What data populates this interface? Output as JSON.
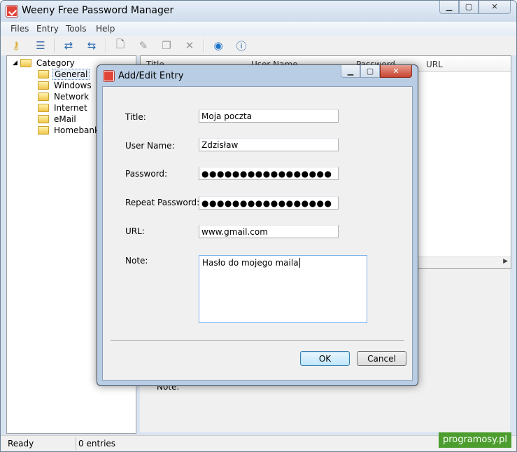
{
  "app": {
    "title": "Weeny Free Password Manager"
  },
  "menu": [
    "Files",
    "Entry",
    "Tools",
    "Help"
  ],
  "toolbar_icons": [
    "key-icon",
    "list-icon",
    "import-icon",
    "export-icon",
    "new-entry-icon",
    "edit-entry-icon",
    "copy-entry-icon",
    "delete-entry-icon",
    "globe-icon",
    "info-icon"
  ],
  "tree": {
    "root": "Category",
    "items": [
      "General",
      "Windows",
      "Network",
      "Internet",
      "eMail",
      "Homebanking"
    ],
    "selected": "General"
  },
  "list": {
    "columns": [
      "Title",
      "User Name",
      "Password",
      "URL"
    ]
  },
  "details": {
    "note_label": "Note:"
  },
  "status": {
    "state": "Ready",
    "count": "0 entries"
  },
  "watermark": "programosy.pl",
  "dialog": {
    "title": "Add/Edit Entry",
    "title_label": "Title:",
    "title_value": "Moja poczta",
    "username_label": "User Name:",
    "username_value": "Zdzisław",
    "password_label": "Password:",
    "password_value": "●●●●●●●●●●●●●●●●●",
    "repeat_label": "Repeat Password:",
    "repeat_value": "●●●●●●●●●●●●●●●●●",
    "url_label": "URL:",
    "url_value": "www.gmail.com",
    "note_label": "Note:",
    "note_value": "Hasło do mojego maila",
    "ok": "OK",
    "cancel": "Cancel"
  }
}
